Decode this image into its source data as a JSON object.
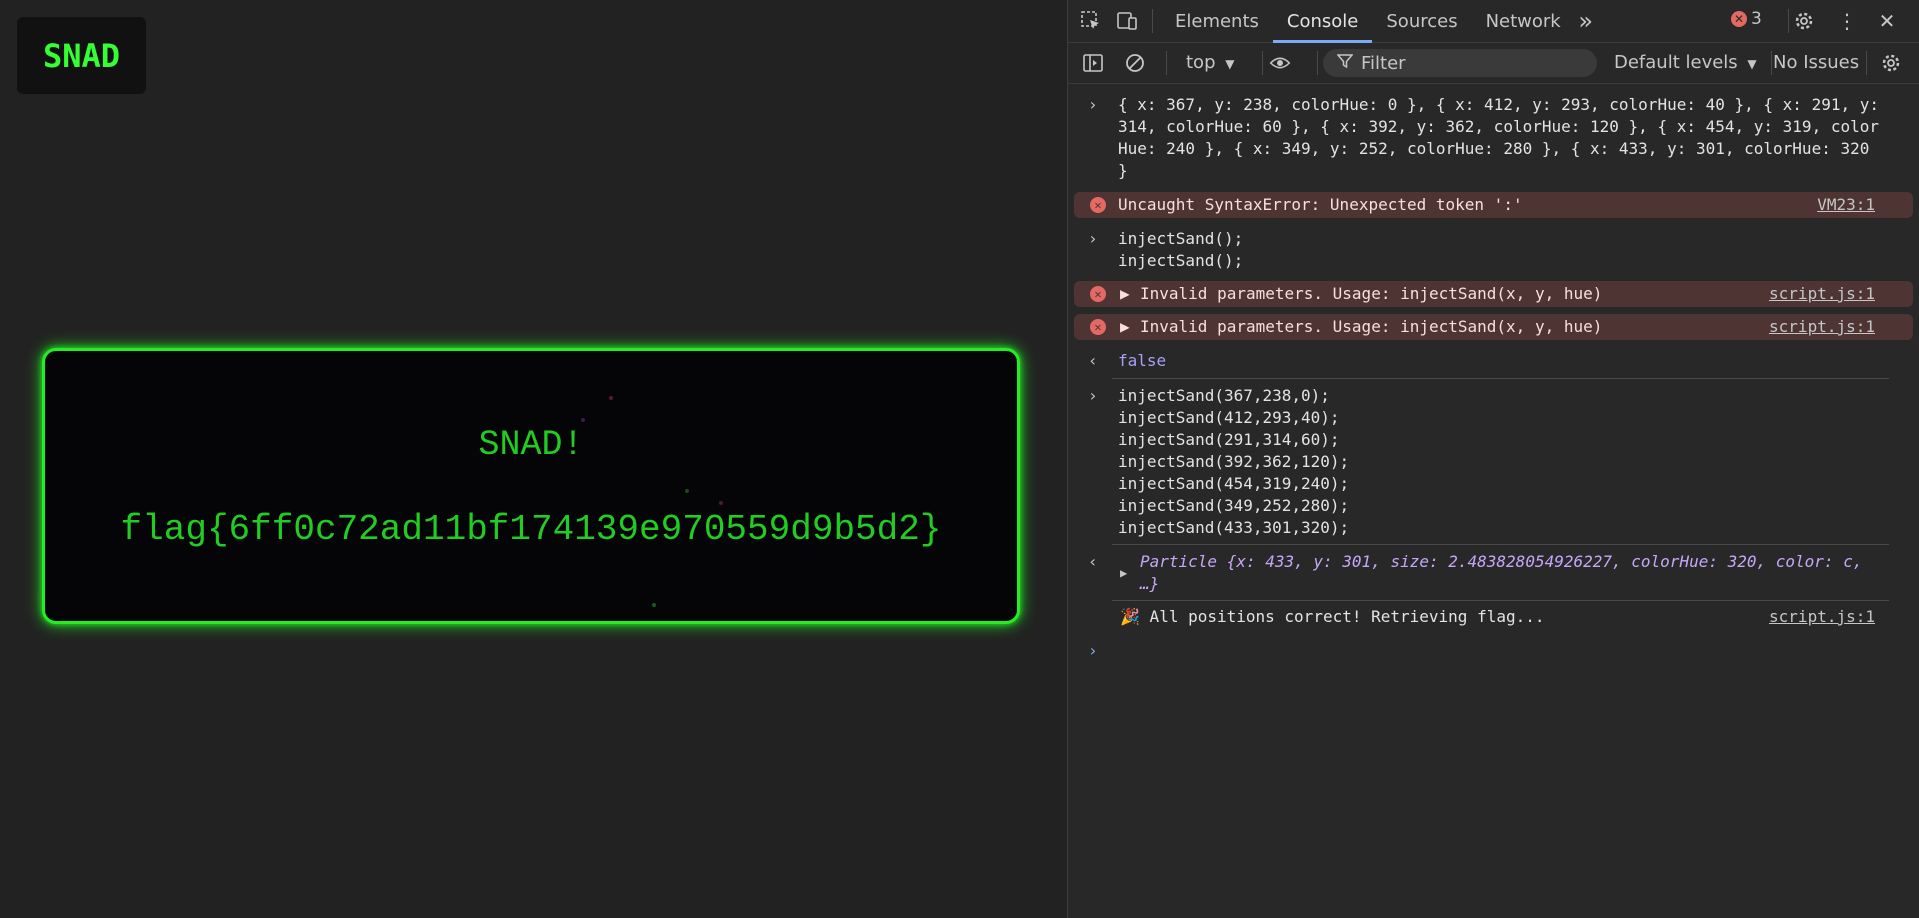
{
  "page": {
    "logo": "SNAD",
    "title": "SNAD!",
    "flag": "flag{6ff0c72ad11bf174139e970559d9b5d2}"
  },
  "devtools": {
    "tabs": [
      "Elements",
      "Console",
      "Sources",
      "Network"
    ],
    "active_tab": "Console",
    "more_tabs": "»",
    "error_count": "3",
    "context": "top",
    "filter_placeholder": "Filter",
    "levels": "Default levels",
    "issues": "No Issues"
  },
  "console": {
    "line1": "{ x: 367, y: 238, colorHue: 0 }, { x: 412, y: 293, colorHue: 40 }, { x: 291, y: 314, colorHue: 60 }, { x: 392, y: 362, colorHue: 120 }, { x: 454, y: 319, colorHue: 240 }, { x: 349, y: 252, colorHue: 280 }, { x: 433, y: 301, colorHue: 320 }",
    "err1": "Uncaught SyntaxError: Unexpected token ':'",
    "err1_link": "VM23:1",
    "input2": "injectSand();\ninjectSand();",
    "err2": "Invalid parameters. Usage: injectSand(x, y, hue)",
    "err2_link": "script.js:1",
    "err3": "Invalid parameters. Usage: injectSand(x, y, hue)",
    "err3_link": "script.js:1",
    "result_false": "false",
    "input3": "injectSand(367,238,0);\ninjectSand(412,293,40);\ninjectSand(291,314,60);\ninjectSand(392,362,120);\ninjectSand(454,319,240);\ninjectSand(349,252,280);\ninjectSand(433,301,320);",
    "particle": "Particle {x: 433, y: 301, size: 2.483828054926227, colorHue: 320, color: c, …}",
    "log": "🎉 All positions correct! Retrieving flag...",
    "log_link": "script.js:1"
  }
}
